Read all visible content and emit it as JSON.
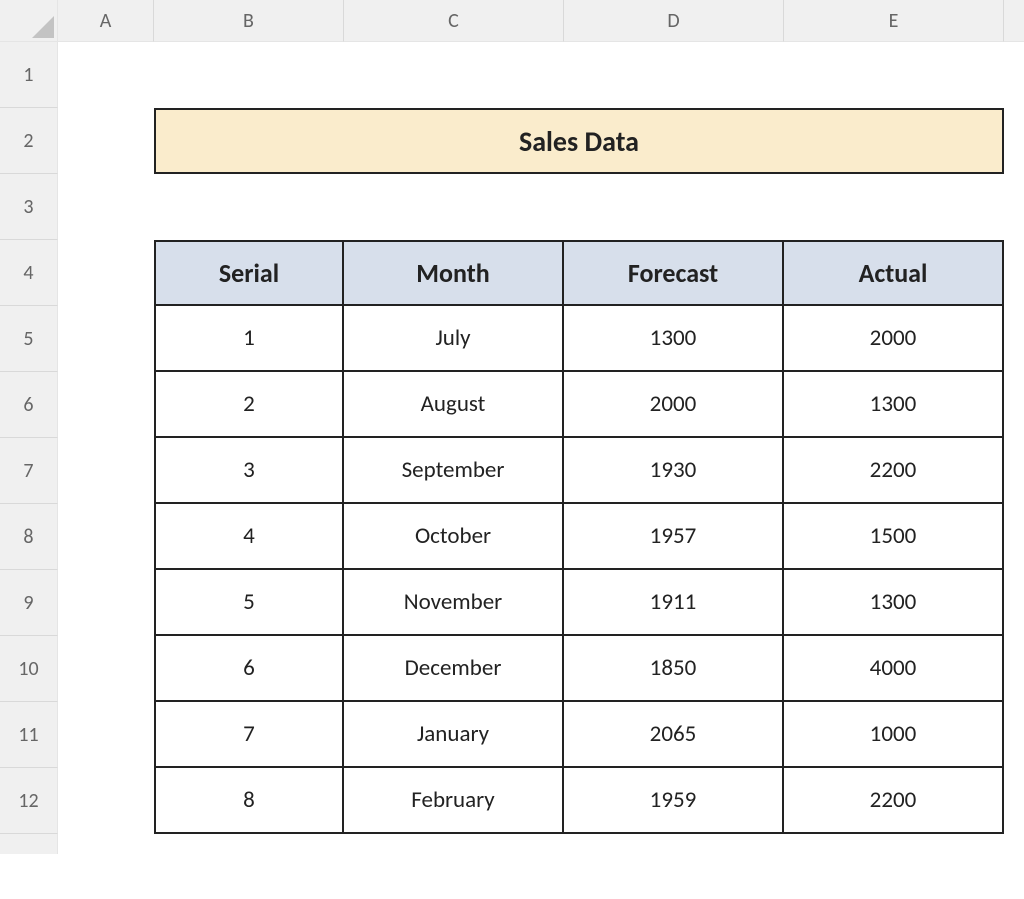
{
  "columns": [
    "A",
    "B",
    "C",
    "D",
    "E"
  ],
  "rows": [
    "1",
    "2",
    "3",
    "4",
    "5",
    "6",
    "7",
    "8",
    "9",
    "10",
    "11",
    "12"
  ],
  "title": "Sales Data",
  "table": {
    "headers": [
      "Serial",
      "Month",
      "Forecast",
      "Actual"
    ],
    "data": [
      {
        "serial": "1",
        "month": "July",
        "forecast": "1300",
        "actual": "2000"
      },
      {
        "serial": "2",
        "month": "August",
        "forecast": "2000",
        "actual": "1300"
      },
      {
        "serial": "3",
        "month": "September",
        "forecast": "1930",
        "actual": "2200"
      },
      {
        "serial": "4",
        "month": "October",
        "forecast": "1957",
        "actual": "1500"
      },
      {
        "serial": "5",
        "month": "November",
        "forecast": "1911",
        "actual": "1300"
      },
      {
        "serial": "6",
        "month": "December",
        "forecast": "1850",
        "actual": "4000"
      },
      {
        "serial": "7",
        "month": "January",
        "forecast": "2065",
        "actual": "1000"
      },
      {
        "serial": "8",
        "month": "February",
        "forecast": "1959",
        "actual": "2200"
      }
    ]
  },
  "chart_data": {
    "type": "table",
    "title": "Sales Data",
    "columns": [
      "Serial",
      "Month",
      "Forecast",
      "Actual"
    ],
    "rows": [
      [
        1,
        "July",
        1300,
        2000
      ],
      [
        2,
        "August",
        2000,
        1300
      ],
      [
        3,
        "September",
        1930,
        2200
      ],
      [
        4,
        "October",
        1957,
        1500
      ],
      [
        5,
        "November",
        1911,
        1300
      ],
      [
        6,
        "December",
        1850,
        4000
      ],
      [
        7,
        "January",
        2065,
        1000
      ],
      [
        8,
        "February",
        1959,
        2200
      ]
    ]
  }
}
